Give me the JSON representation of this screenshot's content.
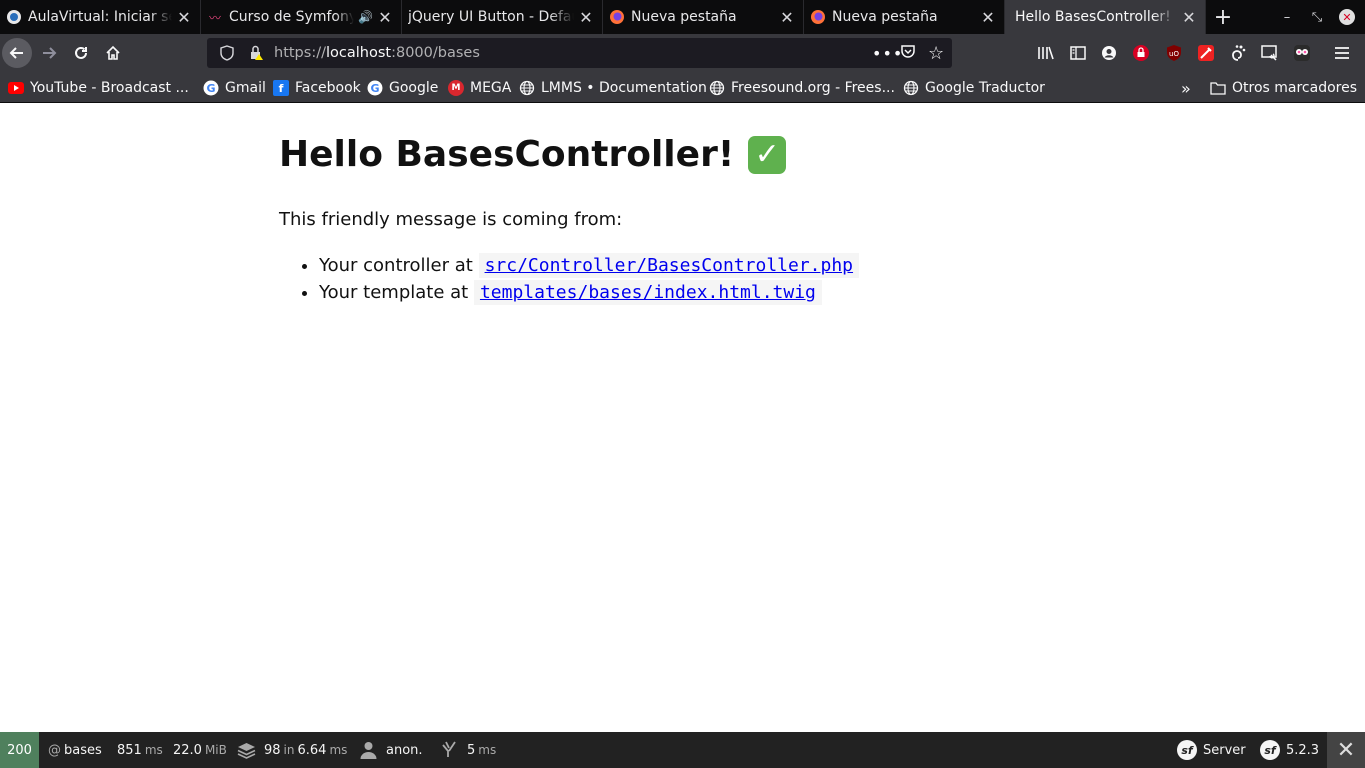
{
  "tabs": [
    {
      "title": "AulaVirtual: Iniciar se",
      "icon": "moodle-icon"
    },
    {
      "title": "Curso de Symfony",
      "icon": "curso-icon",
      "audio": true
    },
    {
      "title": "jQuery UI Button - Defau",
      "icon": "none"
    },
    {
      "title": "Nueva pestaña",
      "icon": "firefox-icon"
    },
    {
      "title": "Nueva pestaña",
      "icon": "firefox-icon"
    },
    {
      "title": "Hello BasesController!",
      "icon": "none",
      "active": true
    }
  ],
  "url": {
    "prefix": "https://",
    "host": "localhost",
    "rest": ":8000/bases"
  },
  "bookmarks": [
    {
      "label": "YouTube - Broadcast ...",
      "icon": "youtube-icon"
    },
    {
      "label": "Gmail",
      "icon": "google-icon"
    },
    {
      "label": "Facebook",
      "icon": "facebook-icon"
    },
    {
      "label": "Google",
      "icon": "google-icon"
    },
    {
      "label": "MEGA",
      "icon": "mega-icon"
    },
    {
      "label": "LMMS • Documentation",
      "icon": "globe-icon"
    },
    {
      "label": "Freesound.org - Frees...",
      "icon": "globe-icon"
    },
    {
      "label": "Google Traductor",
      "icon": "globe-icon"
    }
  ],
  "other_bookmarks": "Otros marcadores",
  "page": {
    "heading": "Hello BasesController!",
    "intro": "This friendly message is coming from:",
    "items": [
      {
        "prefix": "Your controller at",
        "path": "src/Controller/BasesController.php"
      },
      {
        "prefix": "Your template at",
        "path": "templates/bases/index.html.twig"
      }
    ]
  },
  "debug_toolbar": {
    "status": "200",
    "route_at": "@",
    "route": "bases",
    "time": "851",
    "time_unit": "ms",
    "memory": "22.0",
    "memory_unit": "MiB",
    "twig_count": "98",
    "twig_in": "in",
    "twig_time": "6.64",
    "twig_unit": "ms",
    "user": "anon.",
    "events_time": "5",
    "events_unit": "ms",
    "server": "Server",
    "version": "5.2.3"
  },
  "colors": {
    "status_ok": "#4f805d",
    "check": "#5fb14e",
    "link": "#0000ee"
  }
}
